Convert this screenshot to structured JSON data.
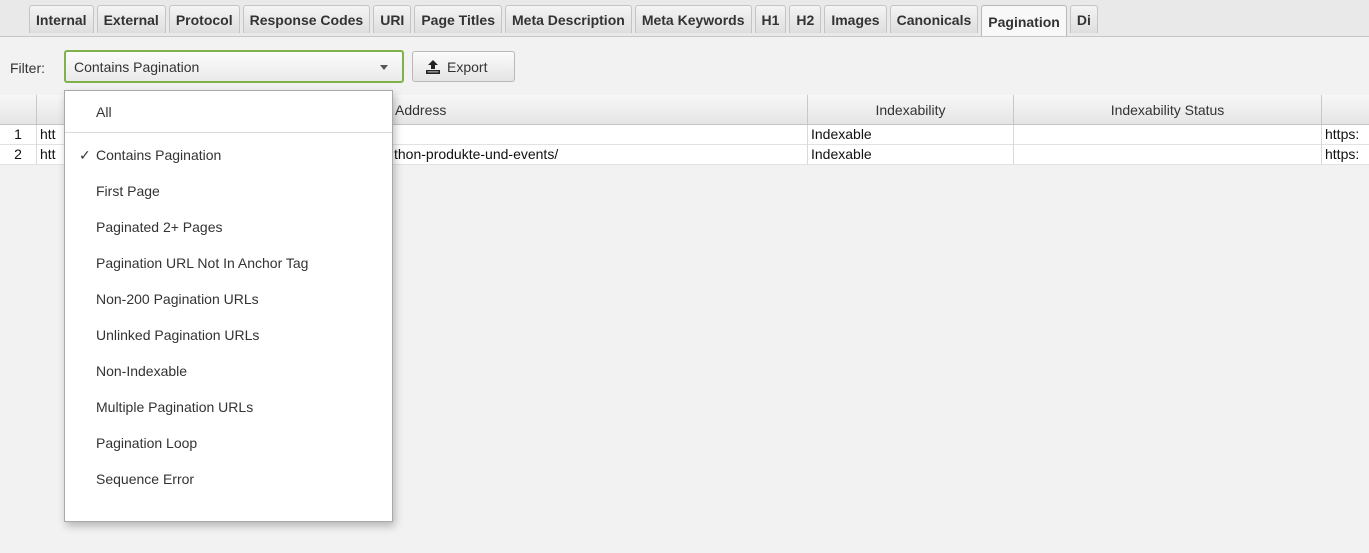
{
  "tabs": [
    {
      "label": "Internal",
      "active": false
    },
    {
      "label": "External",
      "active": false
    },
    {
      "label": "Protocol",
      "active": false
    },
    {
      "label": "Response Codes",
      "active": false
    },
    {
      "label": "URI",
      "active": false
    },
    {
      "label": "Page Titles",
      "active": false
    },
    {
      "label": "Meta Description",
      "active": false
    },
    {
      "label": "Meta Keywords",
      "active": false
    },
    {
      "label": "H1",
      "active": false
    },
    {
      "label": "H2",
      "active": false
    },
    {
      "label": "Images",
      "active": false
    },
    {
      "label": "Canonicals",
      "active": false
    },
    {
      "label": "Pagination",
      "active": true
    },
    {
      "label": "Di",
      "active": false
    }
  ],
  "toolbar": {
    "filter_label": "Filter:",
    "filter_value": "Contains Pagination",
    "export_label": "Export",
    "accent_color": "#7fb24a"
  },
  "table": {
    "columns": [
      "",
      "",
      "Address",
      "Indexability",
      "Indexability Status",
      ""
    ],
    "rows": [
      {
        "num": "1",
        "address_left": "htt",
        "address_right": "",
        "indexability": "Indexable",
        "status": "",
        "next": "https:"
      },
      {
        "num": "2",
        "address_left": "htt",
        "address_right": "thon-produkte-und-events/",
        "indexability": "Indexable",
        "status": "",
        "next": "https:"
      }
    ]
  },
  "dropdown": {
    "items": [
      {
        "label": "All",
        "checked": false
      },
      {
        "label": "Contains Pagination",
        "checked": true
      },
      {
        "label": "First Page",
        "checked": false
      },
      {
        "label": "Paginated 2+ Pages",
        "checked": false
      },
      {
        "label": "Pagination URL Not In Anchor Tag",
        "checked": false
      },
      {
        "label": "Non-200 Pagination URLs",
        "checked": false
      },
      {
        "label": "Unlinked Pagination URLs",
        "checked": false
      },
      {
        "label": "Non-Indexable",
        "checked": false
      },
      {
        "label": "Multiple Pagination URLs",
        "checked": false
      },
      {
        "label": "Pagination Loop",
        "checked": false
      },
      {
        "label": "Sequence Error",
        "checked": false
      }
    ],
    "check_glyph": "✓"
  }
}
